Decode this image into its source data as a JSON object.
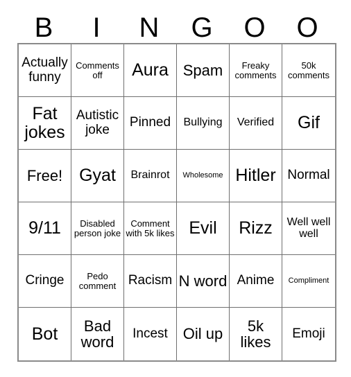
{
  "card": {
    "header_letters": [
      "B",
      "I",
      "N",
      "G",
      "O",
      "O"
    ],
    "columns": 6,
    "rows": 6,
    "border_color": "#6f6f6f",
    "outer_border_color": "#8a8a8a",
    "background_color": "#ffffff",
    "text_color": "#000000",
    "cells": [
      [
        {
          "text": "Actually funny",
          "size": "md"
        },
        {
          "text": "Comments off",
          "size": "xs"
        },
        {
          "text": "Aura",
          "size": "xl"
        },
        {
          "text": "Spam",
          "size": "lg"
        },
        {
          "text": "Freaky comments",
          "size": "xs"
        },
        {
          "text": "50k comments",
          "size": "xs"
        }
      ],
      [
        {
          "text": "Fat jokes",
          "size": "xl"
        },
        {
          "text": "Autistic joke",
          "size": "md"
        },
        {
          "text": "Pinned",
          "size": "md"
        },
        {
          "text": "Bullying",
          "size": "sm"
        },
        {
          "text": "Verified",
          "size": "sm"
        },
        {
          "text": "Gif",
          "size": "xl"
        }
      ],
      [
        {
          "text": "Free!",
          "size": "lg"
        },
        {
          "text": "Gyat",
          "size": "xl"
        },
        {
          "text": "Brainrot",
          "size": "sm"
        },
        {
          "text": "Wholesome",
          "size": "xxs"
        },
        {
          "text": "Hitler",
          "size": "xl"
        },
        {
          "text": "Normal",
          "size": "md"
        }
      ],
      [
        {
          "text": "9/11",
          "size": "xl"
        },
        {
          "text": "Disabled person joke",
          "size": "xs"
        },
        {
          "text": "Comment with 5k likes",
          "size": "xs"
        },
        {
          "text": "Evil",
          "size": "xl"
        },
        {
          "text": "Rizz",
          "size": "xl"
        },
        {
          "text": "Well well well",
          "size": "sm"
        }
      ],
      [
        {
          "text": "Cringe",
          "size": "md"
        },
        {
          "text": "Pedo comment",
          "size": "xs"
        },
        {
          "text": "Racism",
          "size": "md"
        },
        {
          "text": "N word",
          "size": "lg"
        },
        {
          "text": "Anime",
          "size": "md"
        },
        {
          "text": "Compliment",
          "size": "xxs"
        }
      ],
      [
        {
          "text": "Bot",
          "size": "xl"
        },
        {
          "text": "Bad word",
          "size": "lg"
        },
        {
          "text": "Incest",
          "size": "md"
        },
        {
          "text": "Oil up",
          "size": "lg"
        },
        {
          "text": "5k likes",
          "size": "lg"
        },
        {
          "text": "Emoji",
          "size": "md"
        }
      ]
    ]
  }
}
